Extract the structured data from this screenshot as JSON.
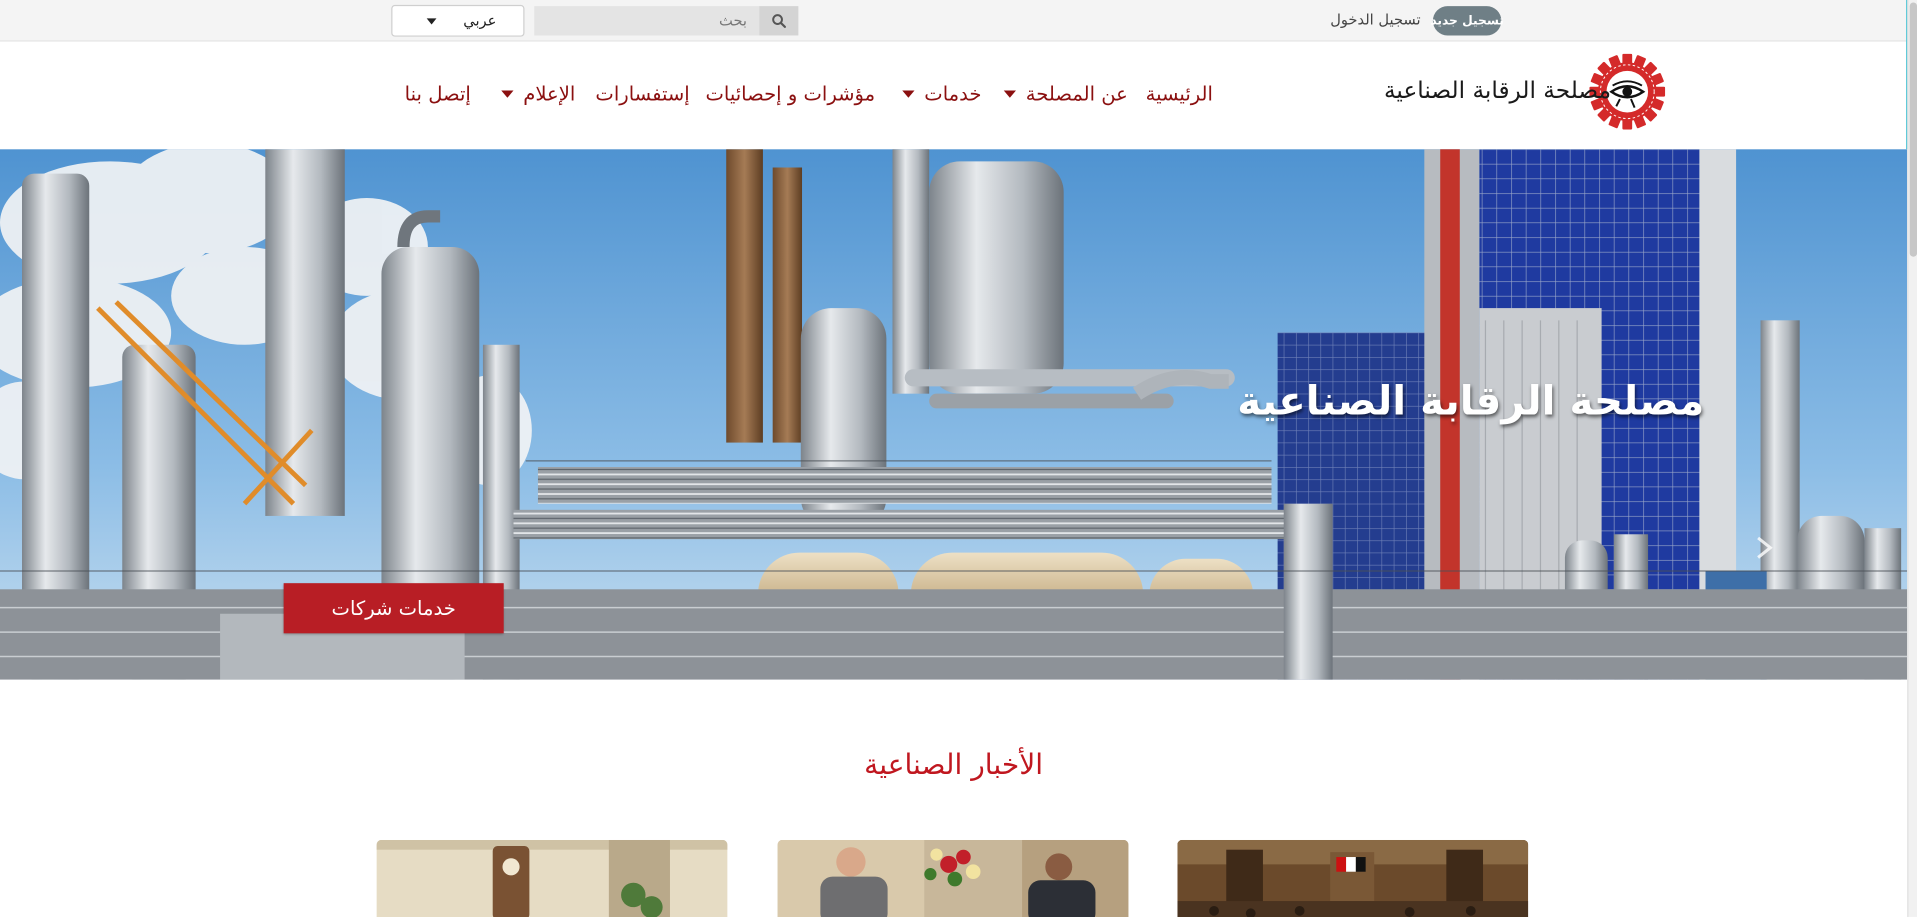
{
  "topbar": {
    "language_selected": "عربي",
    "search_placeholder": "بحث",
    "login_label": "تسجيل الدخول",
    "register_label": "تسجيل جديد"
  },
  "header": {
    "brand_name": "مصلحة الرقابة الصناعية"
  },
  "nav": {
    "items": [
      {
        "label": "الرئيسية",
        "has_dropdown": false
      },
      {
        "label": "عن المصلحة",
        "has_dropdown": true
      },
      {
        "label": "خدمات",
        "has_dropdown": true
      },
      {
        "label": "مؤشرات و إحصائيات",
        "has_dropdown": false
      },
      {
        "label": "إستفسارات",
        "has_dropdown": false
      },
      {
        "label": "الإعلام",
        "has_dropdown": true
      },
      {
        "label": "إتصل بنا",
        "has_dropdown": false
      }
    ]
  },
  "hero": {
    "title": "مصلحة الرقابة الصناعية",
    "cta_label": "خدمات شركات"
  },
  "news": {
    "heading": "الأخبار الصناعية",
    "cards": [
      {
        "image": "parliament-hall-photo"
      },
      {
        "image": "meeting-photo"
      },
      {
        "image": "office-photo"
      }
    ]
  },
  "colors": {
    "nav_text": "#8b1010",
    "accent_red": "#b81e25",
    "news_heading": "#c0171f",
    "badge_gray": "#6f7f86",
    "topbar_bg": "#f4f4f4"
  }
}
